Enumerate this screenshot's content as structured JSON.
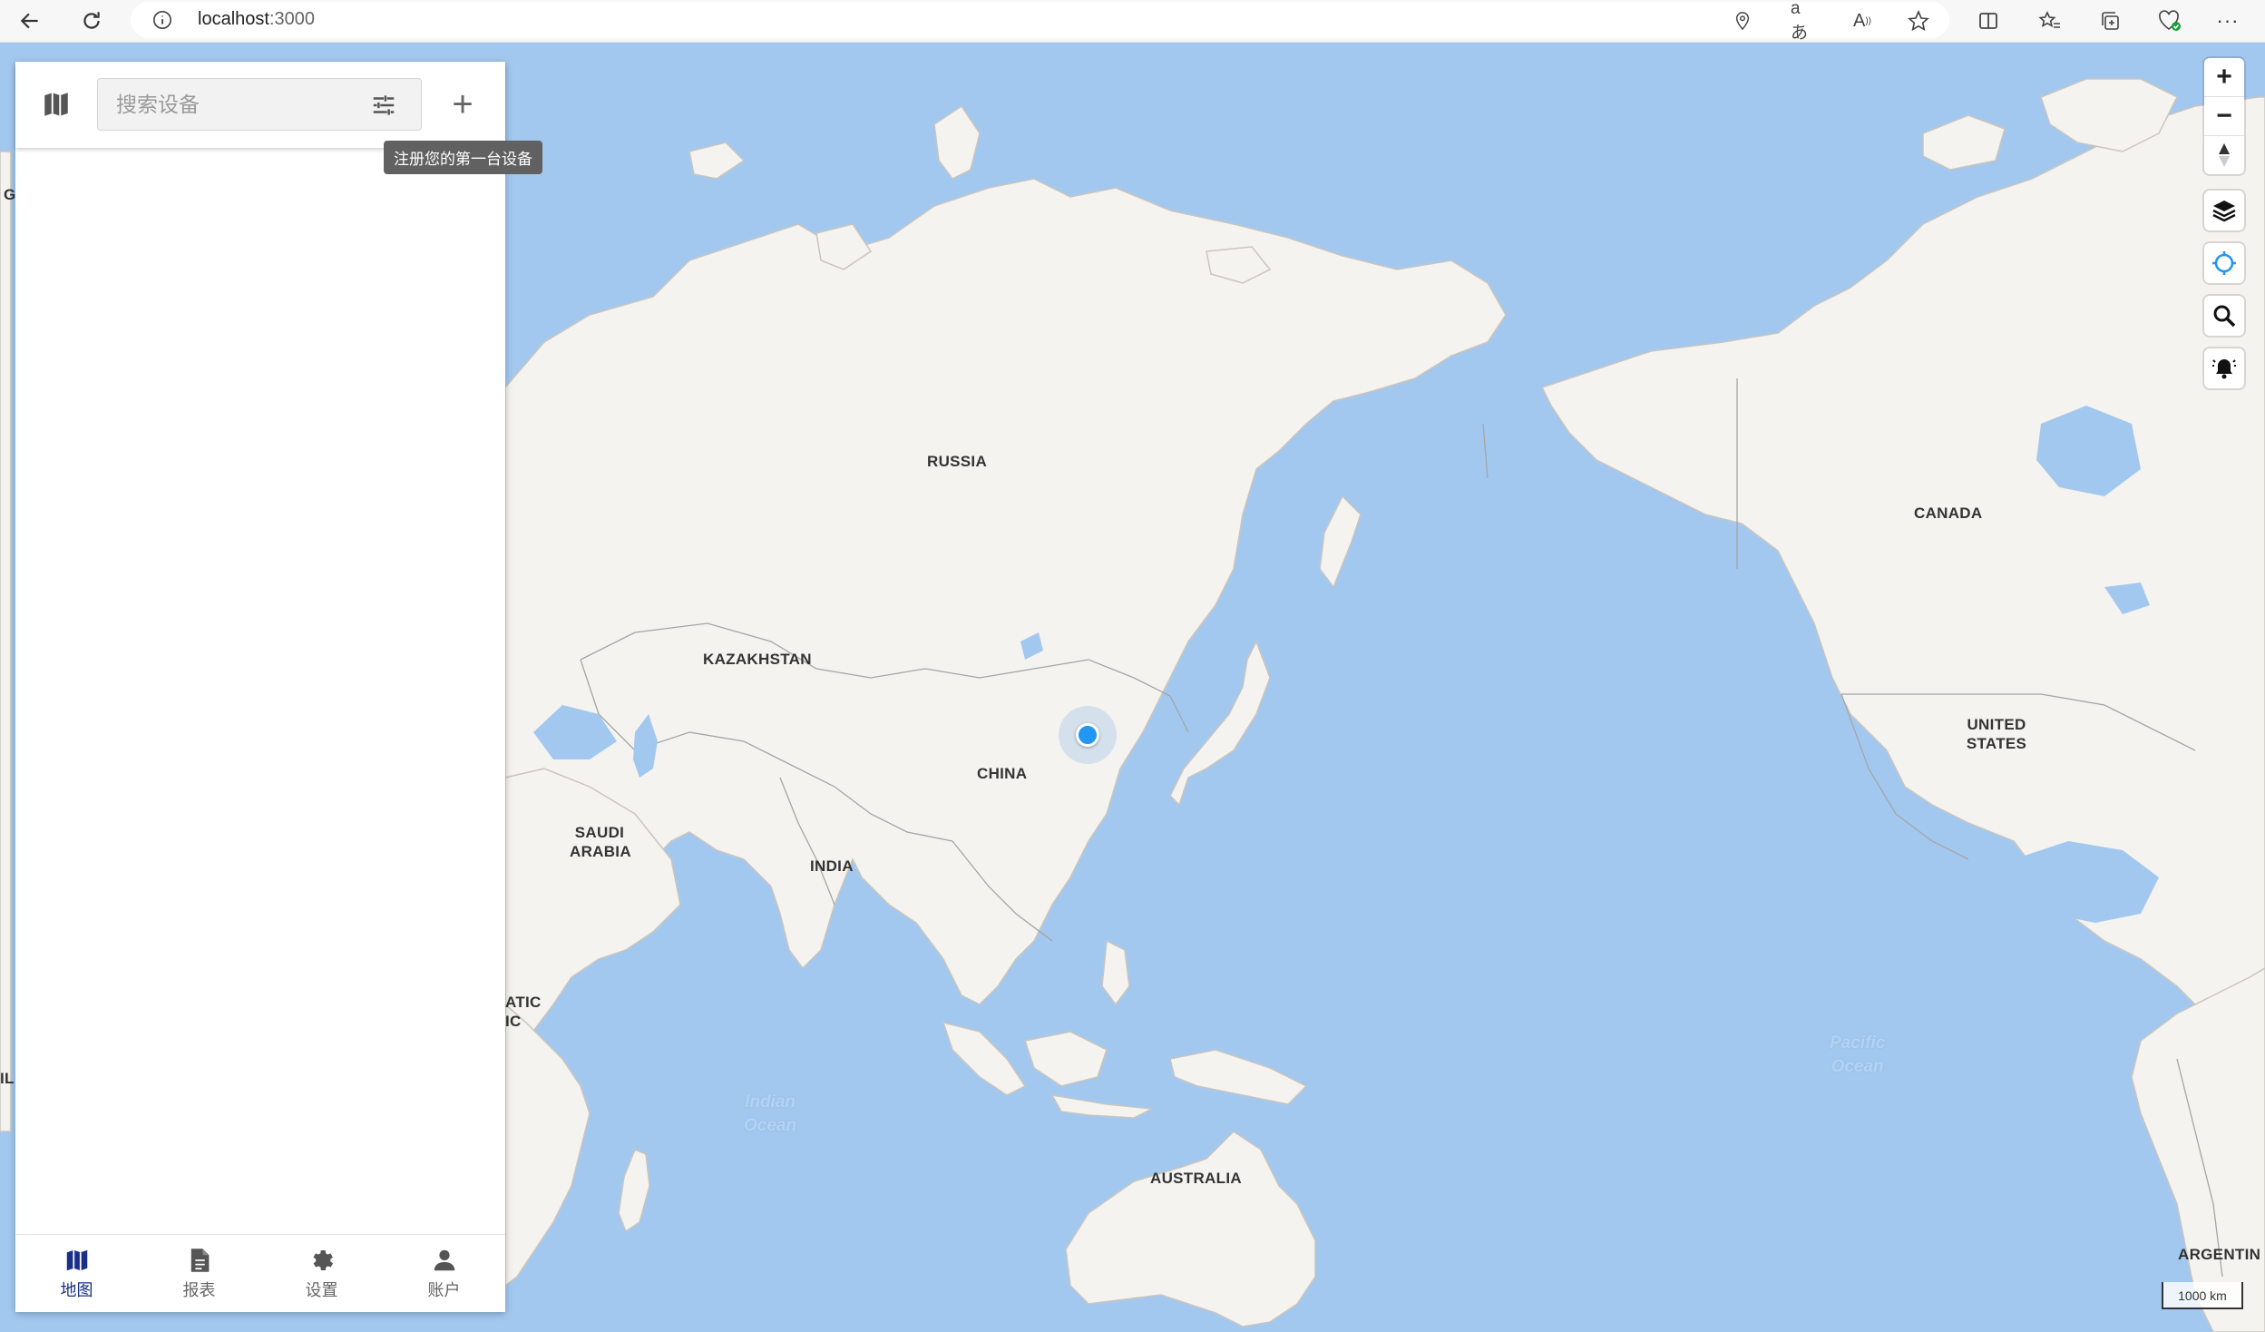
{
  "browser": {
    "url_host": "localhost",
    "url_port": ":3000",
    "icons": [
      "back-arrow-icon",
      "refresh-icon",
      "info-icon",
      "location-icon",
      "read-aloud-aa-icon",
      "font-a-icon",
      "favorite-star-icon",
      "split-screen-icon",
      "favorites-list-icon",
      "collections-icon",
      "browser-essentials-icon",
      "more-menu-icon"
    ]
  },
  "panel": {
    "search_placeholder": "搜索设备",
    "add_tooltip": "注册您的第一台设备",
    "nav": [
      {
        "label": "地图",
        "icon": "map-icon",
        "active": true
      },
      {
        "label": "报表",
        "icon": "report-icon",
        "active": false
      },
      {
        "label": "设置",
        "icon": "gear-icon",
        "active": false
      },
      {
        "label": "账户",
        "icon": "person-icon",
        "active": false
      }
    ]
  },
  "map": {
    "countries": {
      "russia": "RUSSIA",
      "kazakhstan": "KAZAKHSTAN",
      "china": "CHINA",
      "india": "INDIA",
      "saudi_arabia_1": "SAUDI",
      "saudi_arabia_2": "ARABIA",
      "canada": "CANADA",
      "united_states_1": "UNITED",
      "united_states_2": "STATES",
      "australia": "AUSTRALIA",
      "argentina": "ARGENTIN",
      "partial_atic": "ATIC",
      "partial_ic": "IC",
      "partial_g": "G",
      "partial_il": "IL"
    },
    "oceans": {
      "indian_1": "Indian",
      "indian_2": "Ocean",
      "pacific_1": "Pacific",
      "pacific_2": "Ocean"
    },
    "scale": "1000 km",
    "controls": [
      "zoom-in-icon",
      "zoom-out-icon",
      "compass-icon",
      "layers-icon",
      "locate-icon",
      "search-icon",
      "notification-bell-icon"
    ],
    "colors": {
      "water": "#a3c8ef",
      "land": "#f5f3ef",
      "border": "#9a9a9a",
      "location": "#2196f3"
    }
  }
}
